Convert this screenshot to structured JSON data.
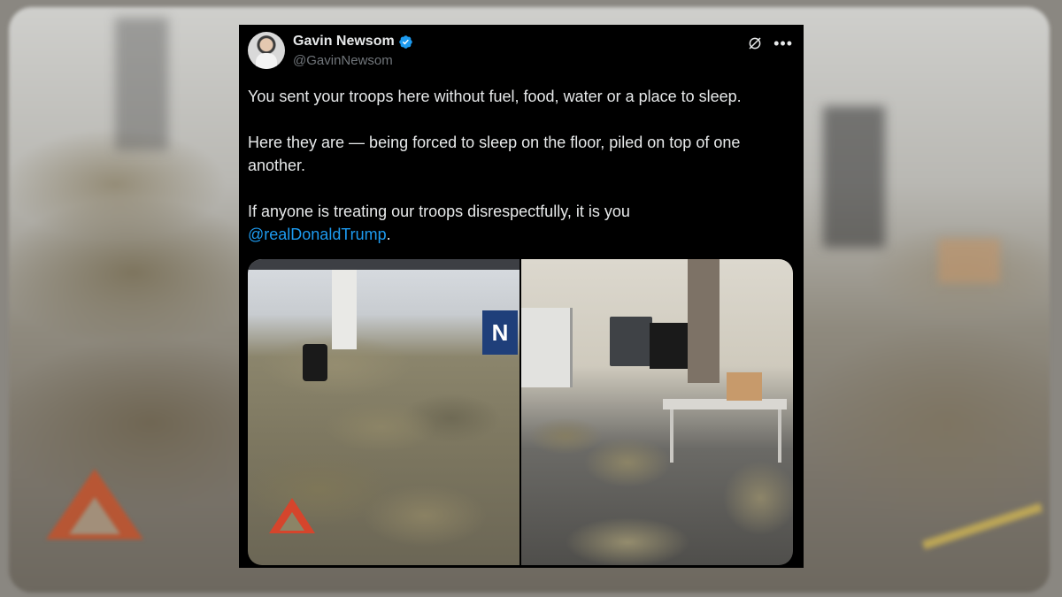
{
  "tweet": {
    "author": {
      "name": "Gavin Newsom",
      "handle": "@GavinNewsom",
      "verified": true
    },
    "paragraphs": [
      "You sent your troops here without fuel, food, water or a place to sleep.",
      "Here they are — being forced to sleep on the floor, piled on top of one another."
    ],
    "last_paragraph": {
      "text": "If anyone is treating our troops disrespectfully, it is you",
      "mention": "@realDonaldTrump",
      "suffix": "."
    },
    "media": {
      "left_sign_letter": "N"
    }
  },
  "icons": {
    "verified": "verified-badge-icon",
    "grok": "grok-icon",
    "more": "more-icon"
  },
  "colors": {
    "background": "#000000",
    "text": "#e7e9ea",
    "secondary_text": "#71767b",
    "link": "#1d9bf0",
    "verified": "#1d9bf0"
  }
}
